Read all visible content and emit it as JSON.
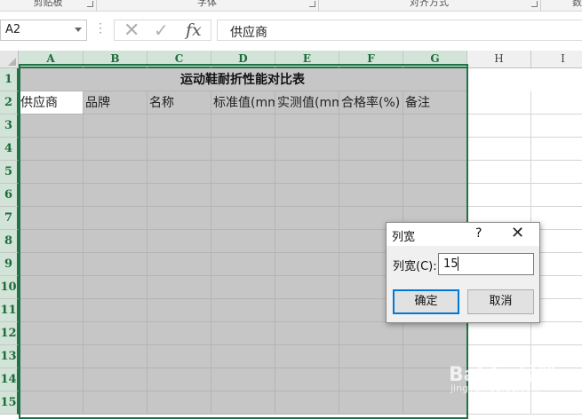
{
  "ribbon": {
    "groups": [
      "剪贴板",
      "字体",
      "对齐方式",
      "数"
    ]
  },
  "formula_bar": {
    "name_box": "A2",
    "fx_label": "fx",
    "content": "供应商"
  },
  "grid": {
    "columns": [
      "A",
      "B",
      "C",
      "D",
      "E",
      "F",
      "G",
      "H",
      "I"
    ],
    "rows": [
      "1",
      "2",
      "3",
      "4",
      "5",
      "6",
      "7",
      "8",
      "9",
      "10",
      "11",
      "12",
      "13",
      "14",
      "15"
    ],
    "title": "运动鞋耐折性能对比表",
    "headers": [
      "供应商",
      "品牌",
      "名称",
      "标准值(mm",
      "实测值(mm",
      "合格率(%)",
      "备注"
    ]
  },
  "dialog": {
    "title": "列宽",
    "help": "?",
    "close": "✕",
    "label": "列宽(C):",
    "value": "15",
    "ok": "确定",
    "cancel": "取消"
  },
  "watermark": {
    "main": "Baidu 经验",
    "sub": "jingyan.baidu.com"
  },
  "colors": {
    "accent": "#217346",
    "selection_fill": "#c6c6c6",
    "dialog_ok_border": "#0078d7"
  }
}
